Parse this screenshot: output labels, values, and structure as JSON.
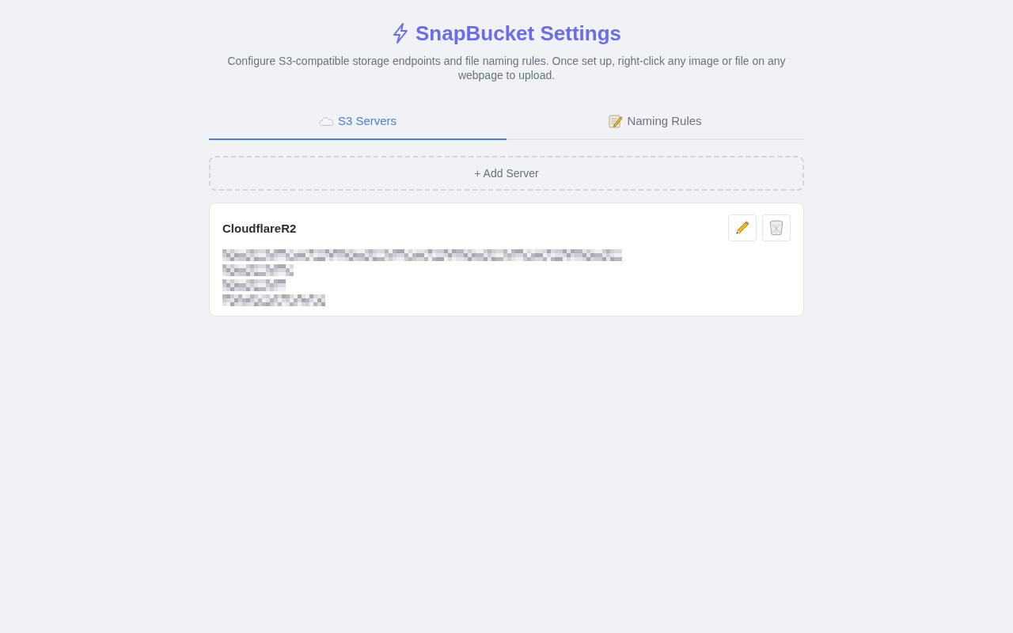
{
  "header": {
    "title": "SnapBucket Settings",
    "subtitle": "Configure S3-compatible storage endpoints and file naming rules. Once set up, right-click any image or file on any webpage to upload."
  },
  "tabs": [
    {
      "label": "S3 Servers",
      "selected": true
    },
    {
      "label": "Naming Rules",
      "selected": false
    }
  ],
  "add_button": {
    "label": "+ Add Server"
  },
  "servers": [
    {
      "name": "CloudflareR2",
      "details_redacted": true
    }
  ]
}
